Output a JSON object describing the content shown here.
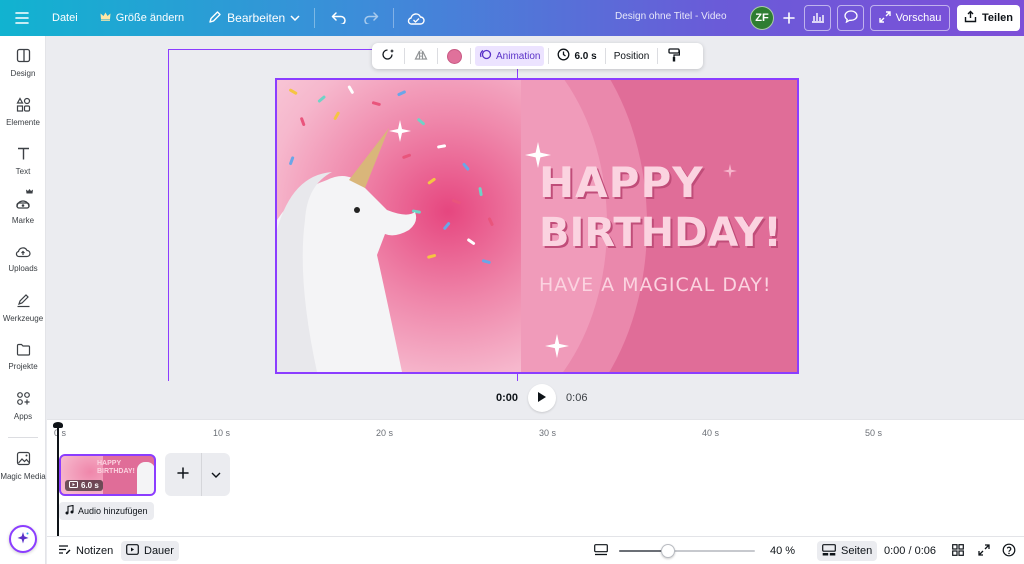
{
  "topbar": {
    "menu_icon": "hamburger-icon",
    "file_label": "Datei",
    "resize_label": "Größe ändern",
    "edit_label": "Bearbeiten",
    "doc_title": "Design ohne Titel - Video",
    "avatar_initials": "ZF",
    "preview_label": "Vorschau",
    "share_label": "Teilen",
    "gradient_start": "#11b3d0",
    "gradient_end": "#7d4fd8"
  },
  "sidebar": {
    "items": [
      {
        "label": "Design",
        "icon": "layout-icon"
      },
      {
        "label": "Elemente",
        "icon": "shapes-icon"
      },
      {
        "label": "Text",
        "icon": "text-icon"
      },
      {
        "label": "Marke",
        "icon": "brand-icon"
      },
      {
        "label": "Uploads",
        "icon": "cloud-upload-icon"
      },
      {
        "label": "Werkzeuge",
        "icon": "pen-icon"
      },
      {
        "label": "Projekte",
        "icon": "folder-icon"
      },
      {
        "label": "Apps",
        "icon": "apps-icon"
      },
      {
        "label": "Magic Media",
        "icon": "magic-media-icon"
      }
    ]
  },
  "context_toolbar": {
    "color": "#e0719b",
    "animation_label": "Animation",
    "duration_label": "6.0 s",
    "position_label": "Position"
  },
  "design": {
    "background": "#e06d98",
    "headline_1": "HAPPY",
    "headline_2": "BIRTHDAY!",
    "subline": "HAVE A MAGICAL DAY!"
  },
  "playback": {
    "current_time": "0:00",
    "total_time": "0:06"
  },
  "timeline": {
    "ruler": [
      "0 s",
      "10 s",
      "20 s",
      "30 s",
      "40 s",
      "50 s"
    ],
    "clip_headline_1": "HAPPY",
    "clip_headline_2": "BIRTHDAY!",
    "clip_duration": "6.0 s",
    "audio_label": "Audio hinzufügen"
  },
  "bottombar": {
    "notes_label": "Notizen",
    "duration_label": "Dauer",
    "zoom_percent": 40,
    "zoom_label": "40 %",
    "pages_label": "Seiten",
    "time_label": "0:00 / 0:06"
  }
}
